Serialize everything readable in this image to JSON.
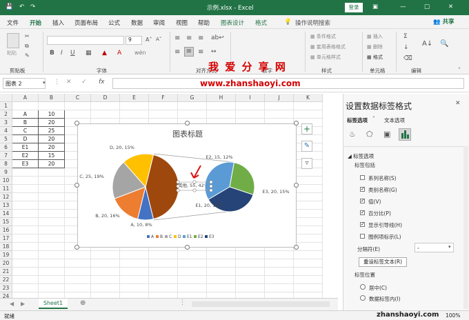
{
  "title_bar": {
    "title": "示例.xlsx - Excel",
    "login": "登录"
  },
  "tabs": [
    "文件",
    "开始",
    "插入",
    "页面布局",
    "公式",
    "数据",
    "审阅",
    "视图",
    "帮助",
    "图表设计",
    "格式",
    "操作说明搜索"
  ],
  "share": "共享",
  "ribbon": {
    "paste": "粘贴",
    "clipboard": "剪贴板",
    "font_group": "字体",
    "align_group": "对齐方式",
    "number_group": "数字",
    "styles_group": "样式",
    "cells_group": "单元格",
    "edit_group": "编辑",
    "font_size": "9",
    "cond_format": "条件格式",
    "table_format": "套用表格格式",
    "cell_style": "单元格样式",
    "insert": "插入",
    "delete": "删除",
    "format": "格式"
  },
  "watermark": {
    "title": "我 爱 分 享 网",
    "url": "www.zhanshaoyi.com"
  },
  "formula_bar": {
    "name_box": "图表 2",
    "fx": "fx"
  },
  "grid": {
    "columns": [
      "A",
      "B",
      "C",
      "D",
      "E",
      "F",
      "G",
      "H",
      "I",
      "J",
      "K"
    ],
    "rows": [
      "1",
      "2",
      "3",
      "4",
      "5",
      "6",
      "7",
      "8",
      "9",
      "10",
      "11",
      "12",
      "13",
      "14",
      "15",
      "16",
      "17",
      "18",
      "19",
      "20",
      "21",
      "22",
      "23",
      "24"
    ],
    "data": [
      [
        "A",
        "10"
      ],
      [
        "B",
        "20"
      ],
      [
        "C",
        "25"
      ],
      [
        "D",
        "20"
      ],
      [
        "E1",
        "20"
      ],
      [
        "E2",
        "15"
      ],
      [
        "E3",
        "20"
      ]
    ]
  },
  "sheet_tab": "Sheet1",
  "status": {
    "ready": "就绪",
    "zoom": "100%",
    "wm": "zhanshaoyi.com"
  },
  "chart_data": {
    "type": "pie",
    "title": "图表标题",
    "primary": [
      {
        "name": "A",
        "value": 10,
        "label": "A, 10, 8%",
        "color": "#4472C4"
      },
      {
        "name": "B",
        "value": 20,
        "label": "B, 20, 16%",
        "color": "#ED7D31"
      },
      {
        "name": "C",
        "value": 25,
        "label": "C, 25, 19%",
        "color": "#A5A5A5"
      },
      {
        "name": "D",
        "value": 20,
        "label": "D, 20, 15%",
        "color": "#FFC000"
      },
      {
        "name": "其他",
        "value": 55,
        "label": "其他, 55, 42%",
        "color": "#9E480E"
      }
    ],
    "secondary": [
      {
        "name": "E1",
        "value": 20,
        "label": "E1, 20, 15%",
        "color": "#5B9BD5"
      },
      {
        "name": "E2",
        "value": 15,
        "label": "E2, 15, 12%",
        "color": "#70AD47"
      },
      {
        "name": "E3",
        "value": 20,
        "label": "E3, 20, 15%",
        "color": "#264478"
      }
    ],
    "legend": [
      "A",
      "B",
      "C",
      "D",
      "E1",
      "E2",
      "E3"
    ],
    "legend_position": "bottom"
  },
  "panel": {
    "title": "设置数据标签格式",
    "tab_label_options": "标签选项",
    "tab_text_options": "文本选项",
    "section": "标签选项",
    "contains": "标签包括",
    "checks": [
      {
        "label": "系列名称(S)",
        "checked": false
      },
      {
        "label": "类别名称(G)",
        "checked": true
      },
      {
        "label": "值(V)",
        "checked": true
      },
      {
        "label": "百分比(P)",
        "checked": true
      },
      {
        "label": "显示引导线(H)",
        "checked": true
      },
      {
        "label": "图例项标示(L)",
        "checked": false
      }
    ],
    "separator_label": "分隔符(E)",
    "separator_value": ",",
    "reset_button": "重设标签文本(R)",
    "position_label": "标签位置",
    "positions": [
      "居中(C)",
      "数据标签内(I)"
    ]
  }
}
